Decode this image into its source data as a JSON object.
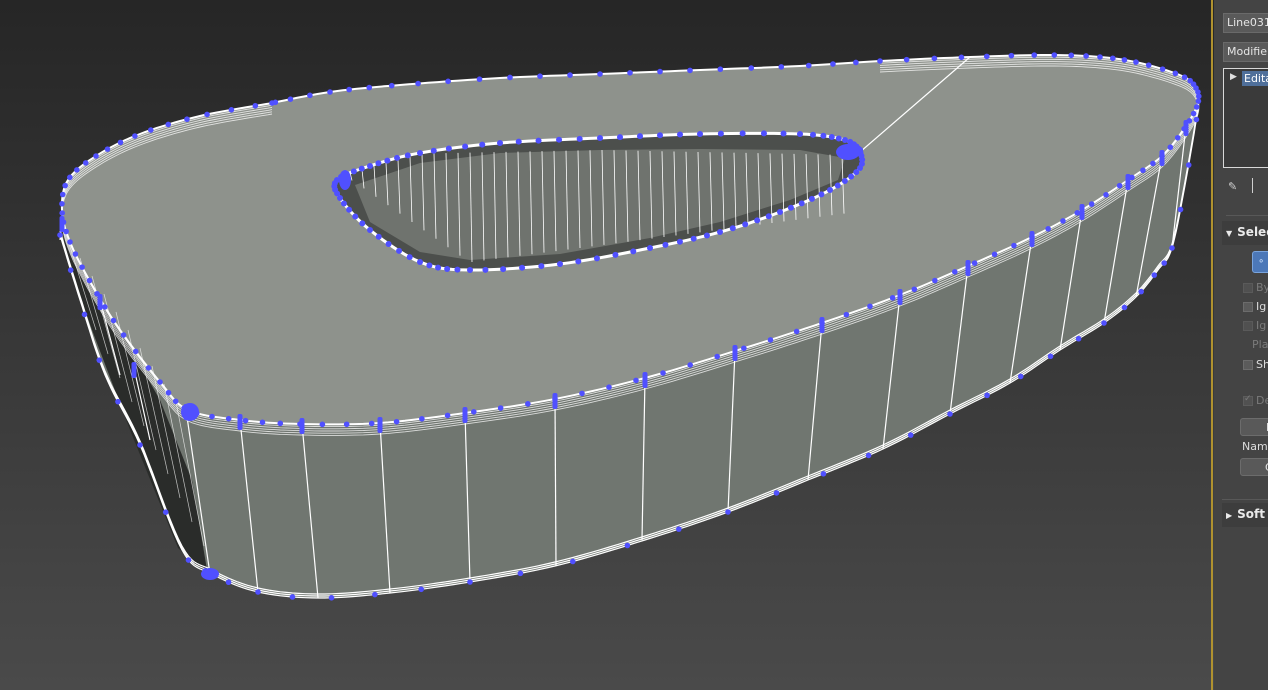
{
  "object_name": "Line031",
  "modifier_list_label": "Modifier",
  "modifier_stack": {
    "items": [
      {
        "label": "Edita"
      }
    ]
  },
  "selection_rollout": {
    "title": "Selec",
    "options": [
      {
        "label": "By",
        "checked": false,
        "enabled": false
      },
      {
        "label": "Ig",
        "checked": false,
        "enabled": true
      },
      {
        "label": "Ig",
        "checked": false,
        "enabled": false
      }
    ],
    "plane_label": "Pla",
    "show_label": "Sh",
    "default_label": "De",
    "default_checked": true,
    "named_label": "Name",
    "button_top_label": "H",
    "button_bottom_label": "C"
  },
  "soft_rollout": {
    "title": "Soft"
  },
  "colors": {
    "vertex": "#5050ff",
    "edge": "#ffffff",
    "viewport_top": "#262626",
    "viewport_bottom": "#4a4a4a",
    "panel_border": "#b0922f"
  }
}
